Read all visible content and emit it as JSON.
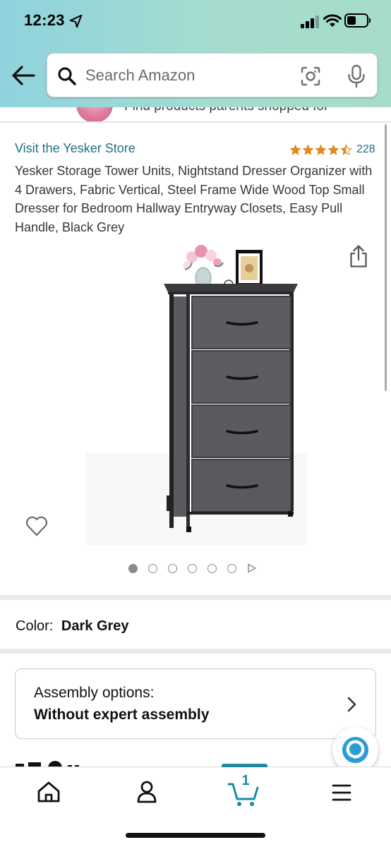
{
  "status_bar": {
    "time": "12:23"
  },
  "search": {
    "placeholder": "Search Amazon"
  },
  "banner": {
    "text": "Find products parents shopped for"
  },
  "product": {
    "store_link": "Visit the Yesker Store",
    "rating_stars": 4.5,
    "rating_count": "228",
    "title": "Yesker Storage Tower Units, Nightstand Dresser Organizer with 4 Drawers, Fabric Vertical, Steel Frame Wide Wood Top Small Dresser for Bedroom Hallway Entryway Closets, Easy Pull Handle, Black Grey",
    "image_count": 6,
    "active_image_index": 0
  },
  "color": {
    "label": "Color:",
    "value": "Dark Grey"
  },
  "assembly": {
    "label": "Assembly options:",
    "value": "Without expert assembly"
  },
  "bottom_nav": {
    "items": [
      "home",
      "account",
      "cart",
      "menu"
    ],
    "cart_count": "1",
    "active": "cart"
  },
  "colors": {
    "link": "#1f6f85",
    "star": "#e58b16",
    "accent": "#1c8aa3",
    "header_gradient_start": "#8fd3de",
    "header_gradient_end": "#a7dcc9"
  }
}
